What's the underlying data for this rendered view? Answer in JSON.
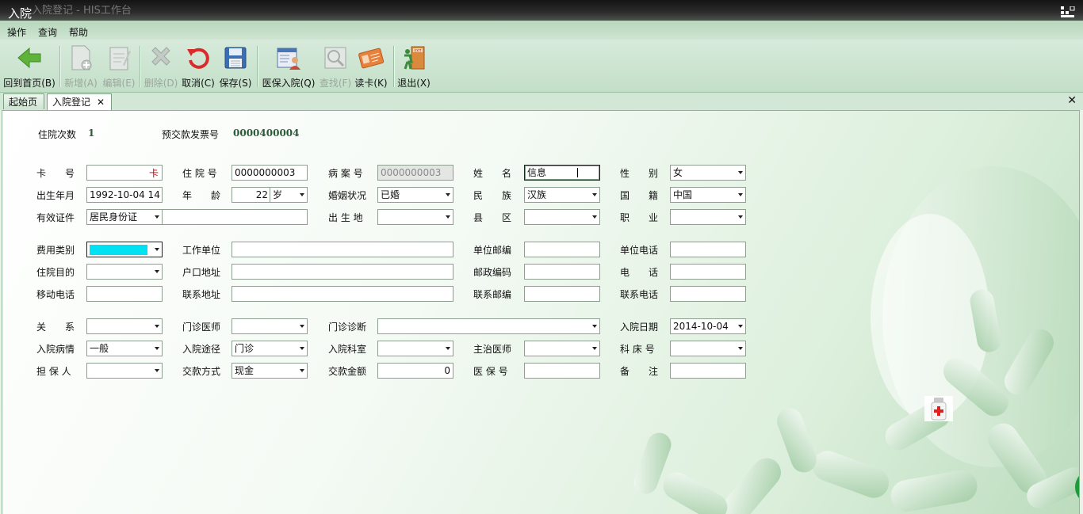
{
  "window": {
    "title": "入院",
    "ghost_title": "入院登记 - HIS工作台"
  },
  "menu": [
    "操作",
    "查询",
    "帮助"
  ],
  "toolbar": {
    "buttons": [
      {
        "label": "回到首页(B)",
        "icon": "back-arrow-icon",
        "enabled": true
      },
      {
        "label": "新增(A)",
        "icon": "new-document-icon",
        "enabled": false
      },
      {
        "label": "编辑(E)",
        "icon": "edit-notepad-icon",
        "enabled": false
      },
      {
        "label": "删除(D)",
        "icon": "delete-x-icon",
        "enabled": false
      },
      {
        "label": "取消(C)",
        "icon": "undo-icon",
        "enabled": true
      },
      {
        "label": "保存(S)",
        "icon": "floppy-save-icon",
        "enabled": true
      },
      {
        "label": "医保入院(Q)",
        "icon": "insurance-admit-icon",
        "enabled": true
      },
      {
        "label": "查找(F)",
        "icon": "magnifier-icon",
        "enabled": false
      },
      {
        "label": "读卡(K)",
        "icon": "id-card-icon",
        "enabled": true
      },
      {
        "label": "退出(X)",
        "icon": "exit-door-icon",
        "enabled": true
      }
    ]
  },
  "tabs": [
    {
      "label": "起始页",
      "active": false
    },
    {
      "label": "入院登记",
      "active": true
    }
  ],
  "header": {
    "visits_label": "住院次数",
    "visits_value": "1",
    "invoice_label": "预交款发票号",
    "invoice_value": "0000400004"
  },
  "labels": {
    "card": "卡　　号",
    "inpatient_no": "住 院 号",
    "record_no": "病 案 号",
    "name": "姓　　名",
    "gender": "性　　别",
    "birth": "出生年月",
    "age": "年　　龄",
    "marital": "婚姻状况",
    "ethnic": "民　　族",
    "nationality": "国　　籍",
    "id_type": "有效证件",
    "birthplace": "出 生 地",
    "county": "县　　区",
    "occupation": "职　　业",
    "fee_type": "费用类别",
    "employer": "工作单位",
    "employer_zip": "单位邮编",
    "employer_phone": "单位电话",
    "purpose": "住院目的",
    "household_addr": "户口地址",
    "postal_code": "邮政编码",
    "phone": "电　　话",
    "mobile": "移动电话",
    "contact_addr": "联系地址",
    "contact_zip": "联系邮编",
    "contact_phone": "联系电话",
    "relation": "关　　系",
    "outpatient_doctor": "门诊医师",
    "outpatient_diag": "门诊诊断",
    "admit_date": "入院日期",
    "admit_condition": "入院病情",
    "admit_route": "入院途径",
    "admit_dept": "入院科室",
    "attending": "主治医师",
    "ward_bed": "科 床 号",
    "guarantor": "担 保 人",
    "pay_method": "交款方式",
    "pay_amount": "交款金额",
    "insurance_no": "医 保 号",
    "remarks": "备　　注"
  },
  "values": {
    "card_hint": "卡",
    "inpatient_no": "0000000003",
    "record_no": "0000000003",
    "name": "信息",
    "gender": "女",
    "birth": "1992-10-04 14",
    "age": "22",
    "age_unit": "岁",
    "marital": "已婚",
    "ethnic": "汉族",
    "nationality": "中国",
    "id_type": "居民身份证",
    "admit_date": "2014-10-04",
    "admit_condition": "一般",
    "admit_route": "门诊",
    "pay_method": "现金",
    "pay_amount": "0"
  },
  "colors": {
    "accent_green": "#2a5a3a",
    "selection_cyan": "#00e1f4",
    "card_hint_red": "#c00000"
  }
}
